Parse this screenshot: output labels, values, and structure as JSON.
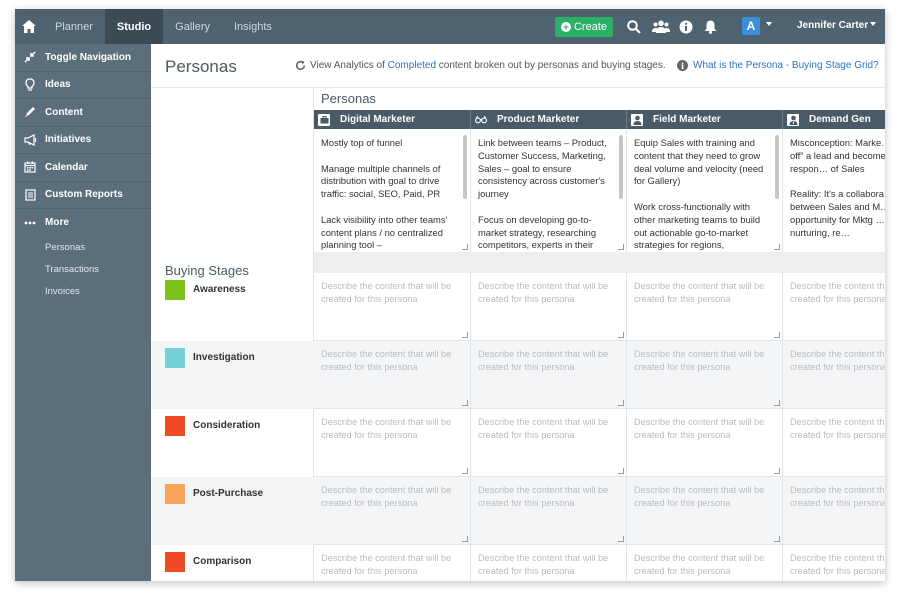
{
  "topbar": {
    "tabs": [
      "Planner",
      "Studio",
      "Gallery",
      "Insights"
    ],
    "active_tab": "Studio",
    "create_label": "Create",
    "avatar_letter": "A",
    "user_name": "Jennifer Carter"
  },
  "sidebar": {
    "items": [
      {
        "label": "Toggle Navigation",
        "icon": "collapse-icon"
      },
      {
        "label": "Ideas",
        "icon": "lightbulb-icon"
      },
      {
        "label": "Content",
        "icon": "pencil-icon"
      },
      {
        "label": "Initiatives",
        "icon": "megaphone-icon"
      },
      {
        "label": "Calendar",
        "icon": "calendar-icon"
      },
      {
        "label": "Custom Reports",
        "icon": "report-icon"
      },
      {
        "label": "More",
        "icon": "ellipsis-icon"
      }
    ],
    "subitems": [
      "Personas",
      "Transactions",
      "Invoices"
    ]
  },
  "header": {
    "title": "Personas",
    "analytics_prefix": "View Analytics of",
    "analytics_link": "Completed",
    "analytics_suffix": "content broken out by personas and buying stages.",
    "help_link": "What is the Persona - Buying Stage Grid?"
  },
  "grid": {
    "personas_heading": "Personas",
    "stages_heading": "Buying Stages",
    "placeholder": "Describe the content that will be created for this persona",
    "personas": [
      {
        "name": "Digital Marketer",
        "icon": "briefcase-icon",
        "description": "Mostly top of funnel\n\nManage multiple channels of distribution with goal to drive traffic: social, SEO, Paid, PR\n\nLack visibility into other teams' content plans / no centralized planning tool –"
      },
      {
        "name": "Product Marketer",
        "icon": "binoculars-icon",
        "description": "Link between teams – Product, Customer Success, Marketing, Sales – goal to ensure consistency across customer's journey\n\nFocus on developing go-to-market strategy, researching competitors, experts in their"
      },
      {
        "name": "Field Marketer",
        "icon": "user-icon",
        "description": "Equip Sales with training and content that they need to grow deal volume and velocity (need for Gallery)\n\nWork cross-functionally with other marketing teams to build out actionable go-to-market strategies for regions,"
      },
      {
        "name": "Demand Gen",
        "icon": "user-tie-icon",
        "description": "Misconception: Marke… “hands off” a lead and becomes sole respon… of Sales\n\nReality: It's a collabora… between Sales and M… opportunity for Mktg … continue nurturing, re…"
      }
    ],
    "stages": [
      {
        "name": "Awareness",
        "color": "#7ac31d"
      },
      {
        "name": "Investigation",
        "color": "#76d2d2"
      },
      {
        "name": "Consideration",
        "color": "#ee4a22"
      },
      {
        "name": "Post-Purchase",
        "color": "#f8a55a"
      },
      {
        "name": "Comparison",
        "color": "#ee4a22"
      }
    ]
  }
}
